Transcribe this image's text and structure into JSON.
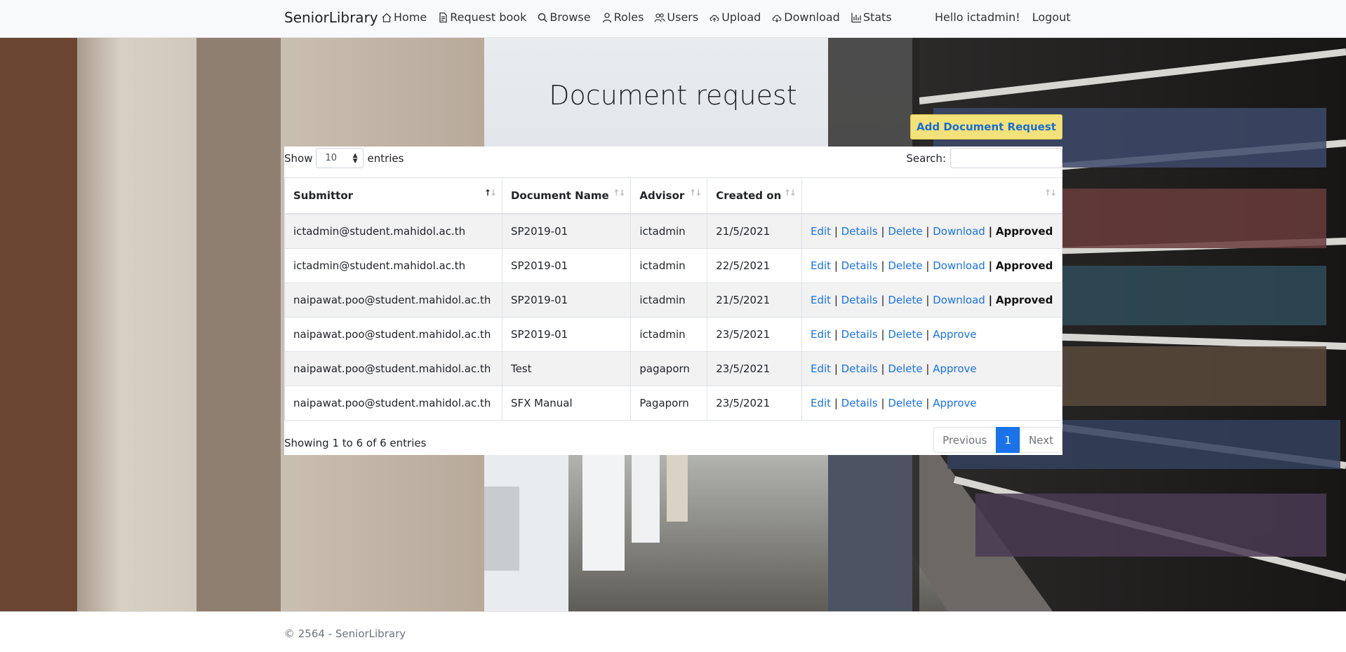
{
  "navbar": {
    "brand": "SeniorLibrary",
    "links": [
      {
        "label": "Home",
        "icon": "house-icon"
      },
      {
        "label": "Request book",
        "icon": "document-icon"
      },
      {
        "label": "Browse",
        "icon": "search-icon"
      },
      {
        "label": "Roles",
        "icon": "person-icon"
      },
      {
        "label": "Users",
        "icon": "people-icon"
      },
      {
        "label": "Upload",
        "icon": "cloud-upload-icon"
      },
      {
        "label": "Download",
        "icon": "cloud-download-icon"
      },
      {
        "label": "Stats",
        "icon": "bar-chart-icon"
      }
    ],
    "greeting": "Hello ictadmin!",
    "logout": "Logout"
  },
  "page": {
    "title": "Document request",
    "add_button": "Add Document Request"
  },
  "table": {
    "length": {
      "show": "Show",
      "value": "10",
      "entries": "entries"
    },
    "search": {
      "label": "Search:",
      "value": ""
    },
    "columns": [
      "Submittor",
      "Document Name",
      "Advisor",
      "Created on",
      ""
    ],
    "sorted_column": "Submittor",
    "rows": [
      {
        "submittor": "ictadmin@student.mahidol.ac.th",
        "document": "SP2019-01",
        "advisor": "ictadmin",
        "created": "21/5/2021",
        "edit": "Edit",
        "details": "Details",
        "delete": "Delete",
        "download": "Download",
        "status": "Approved"
      },
      {
        "submittor": "ictadmin@student.mahidol.ac.th",
        "document": "SP2019-01",
        "advisor": "ictadmin",
        "created": "22/5/2021",
        "edit": "Edit",
        "details": "Details",
        "delete": "Delete",
        "download": "Download",
        "status": "Approved"
      },
      {
        "submittor": "naipawat.poo@student.mahidol.ac.th",
        "document": "SP2019-01",
        "advisor": "ictadmin",
        "created": "21/5/2021",
        "edit": "Edit",
        "details": "Details",
        "delete": "Delete",
        "download": "Download",
        "status": "Approved"
      },
      {
        "submittor": "naipawat.poo@student.mahidol.ac.th",
        "document": "SP2019-01",
        "advisor": "ictadmin",
        "created": "23/5/2021",
        "edit": "Edit",
        "details": "Details",
        "delete": "Delete",
        "approve": "Approve"
      },
      {
        "submittor": "naipawat.poo@student.mahidol.ac.th",
        "document": "Test",
        "advisor": "pagaporn",
        "created": "23/5/2021",
        "edit": "Edit",
        "details": "Details",
        "delete": "Delete",
        "approve": "Approve"
      },
      {
        "submittor": "naipawat.poo@student.mahidol.ac.th",
        "document": "SFX Manual",
        "advisor": "Pagaporn",
        "created": "23/5/2021",
        "edit": "Edit",
        "details": "Details",
        "delete": "Delete",
        "approve": "Approve"
      }
    ],
    "info": "Showing 1 to 6 of 6 entries",
    "pagination": {
      "previous": "Previous",
      "current": "1",
      "next": "Next"
    }
  },
  "footer": {
    "text": "© 2564 - SeniorLibrary"
  },
  "colors": {
    "link": "#1a73e8",
    "add_button_bg": "#f3e27a",
    "add_button_text": "#1a6fd1",
    "navbar_bg": "#f8f9fa"
  }
}
